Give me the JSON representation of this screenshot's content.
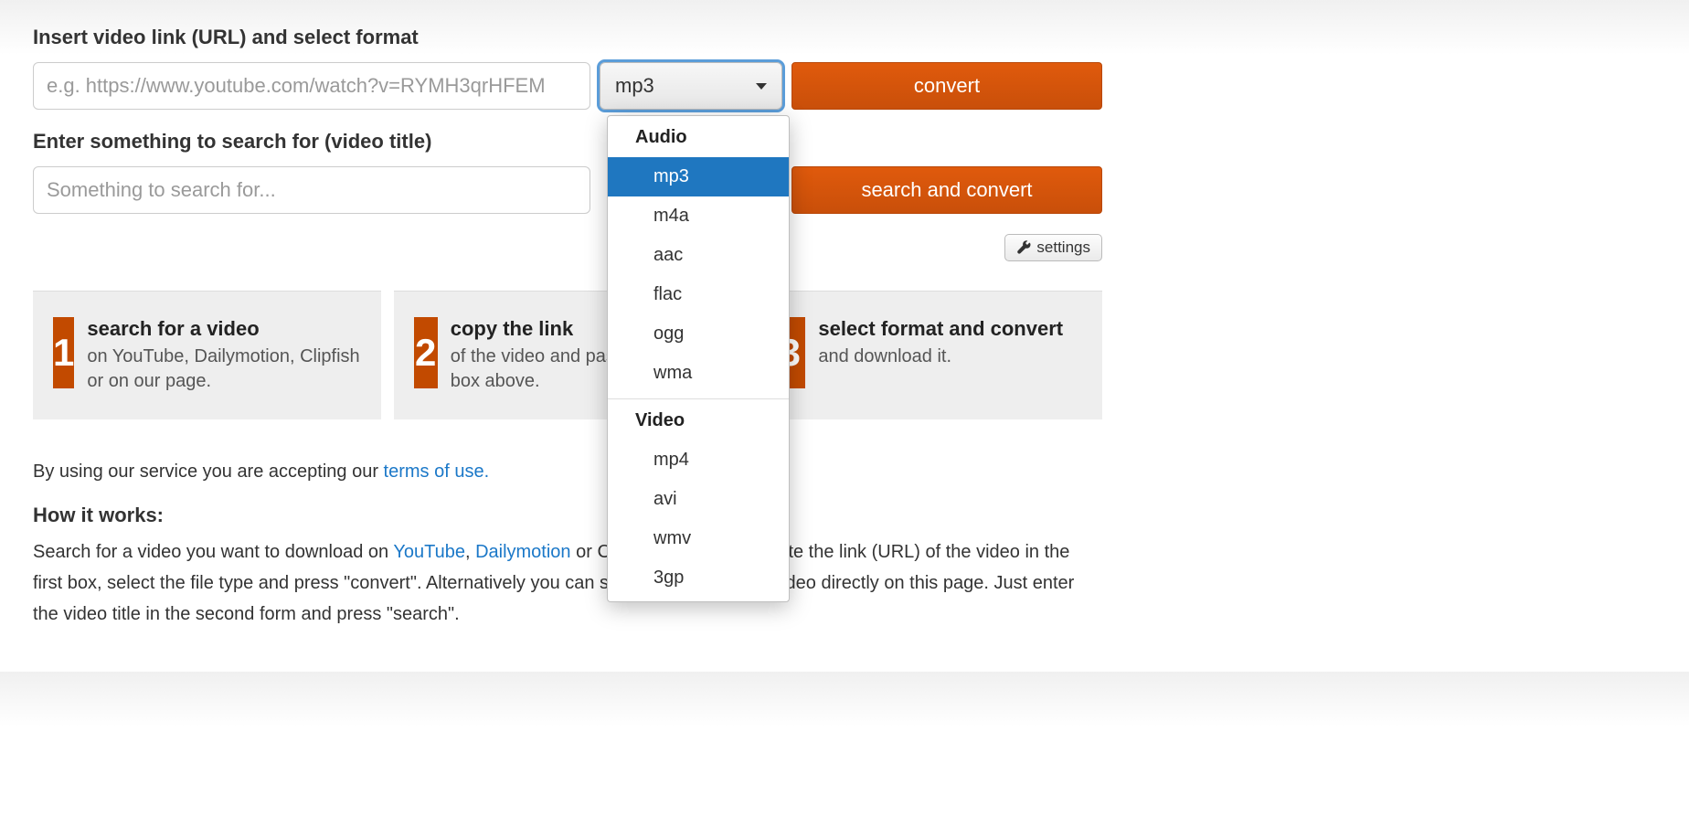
{
  "labels": {
    "url_label": "Insert video link (URL) and select format",
    "search_label": "Enter something to search for (video title)"
  },
  "inputs": {
    "url_placeholder": "e.g. https://www.youtube.com/watch?v=RYMH3qrHFEM",
    "search_placeholder": "Something to search for...",
    "format_selected": "mp3"
  },
  "buttons": {
    "convert": "convert",
    "search_convert": "search and convert",
    "settings": "settings"
  },
  "dropdown": {
    "groups": [
      {
        "label": "Audio",
        "items": [
          "mp3",
          "m4a",
          "aac",
          "flac",
          "ogg",
          "wma"
        ]
      },
      {
        "label": "Video",
        "items": [
          "mp4",
          "avi",
          "wmv",
          "3gp"
        ]
      }
    ],
    "selected": "mp3"
  },
  "steps": [
    {
      "num": "1",
      "title": "search for a video",
      "desc": "on YouTube, Dailymotion, Clipfish or on our page."
    },
    {
      "num": "2",
      "title": "copy the link",
      "desc": "of the video and paste it into the box above."
    },
    {
      "num": "3",
      "title": "select format and convert",
      "desc": "and download it."
    }
  ],
  "terms": {
    "prefix": "By using our service you are accepting our ",
    "link": "terms of use.",
    "howitworks": "How it works:",
    "body_before": "Search for a video you want to download on ",
    "yt": "YouTube",
    "comma": ", ",
    "dm": "Dailymotion",
    "body_mid": " or Clipfish and copy & paste the link (URL) of the video in the first box, select the file type and press \"convert\". Alternatively you can search for a Youtube video directly on this page. Just enter the video title in the second form and press \"search\"."
  }
}
